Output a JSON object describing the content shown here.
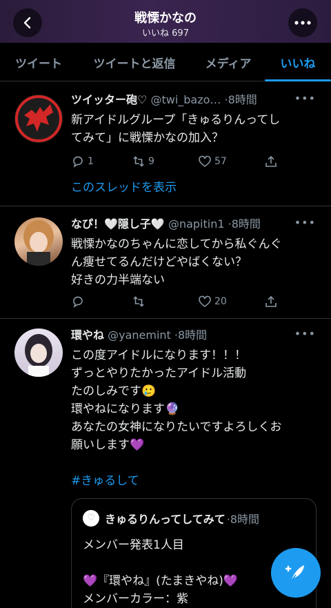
{
  "header": {
    "title": "戦慄かなの",
    "subtitle": "いいね 697"
  },
  "tabs": [
    {
      "label": "ツイート"
    },
    {
      "label": "ツイートと返信"
    },
    {
      "label": "メディア"
    },
    {
      "label": "いいね",
      "active": true
    }
  ],
  "tweets": [
    {
      "name": "ツイッター砲♡",
      "handle": "@twi_bazo…",
      "time": "·8時間",
      "lines": [
        "新アイドルグループ「きゅるりんってし",
        "てみて」に戦慄かなの加入？"
      ],
      "replies": "1",
      "retweets": "9",
      "likes": "57",
      "thread_link": "このスレッドを表示"
    },
    {
      "name": "なぴ！🤍隠し子🤍",
      "handle": "@napitin1",
      "time": "·8時間",
      "lines": [
        "戦慄かなのちゃんに恋してから私ぐんぐ",
        "ん痩せてるんだけどやばくない？",
        "好きの力半端ない"
      ],
      "replies": "",
      "retweets": "",
      "likes": "20"
    },
    {
      "name": "環やね",
      "handle": "@yanemint",
      "time": "·8時間",
      "lines": [
        "この度アイドルになります！！！",
        "ずっとやりたかったアイドル活動",
        "たのしみです🥲",
        "環やねになります🔮",
        "あなたの女神になりたいですよろしくお",
        "願いします💜"
      ],
      "hashtag": "#きゅるして",
      "quote": {
        "name": "きゅるりんってしてみて",
        "time": "·8時間",
        "line1": "メンバー発表1人目",
        "line2": "💜『環やね』(たまきやね)💜",
        "line3": "メンバーカラー：紫"
      }
    }
  ],
  "colors": {
    "accent": "#1d9bf0",
    "muted": "#8b98a5",
    "divider": "#2f3336"
  }
}
